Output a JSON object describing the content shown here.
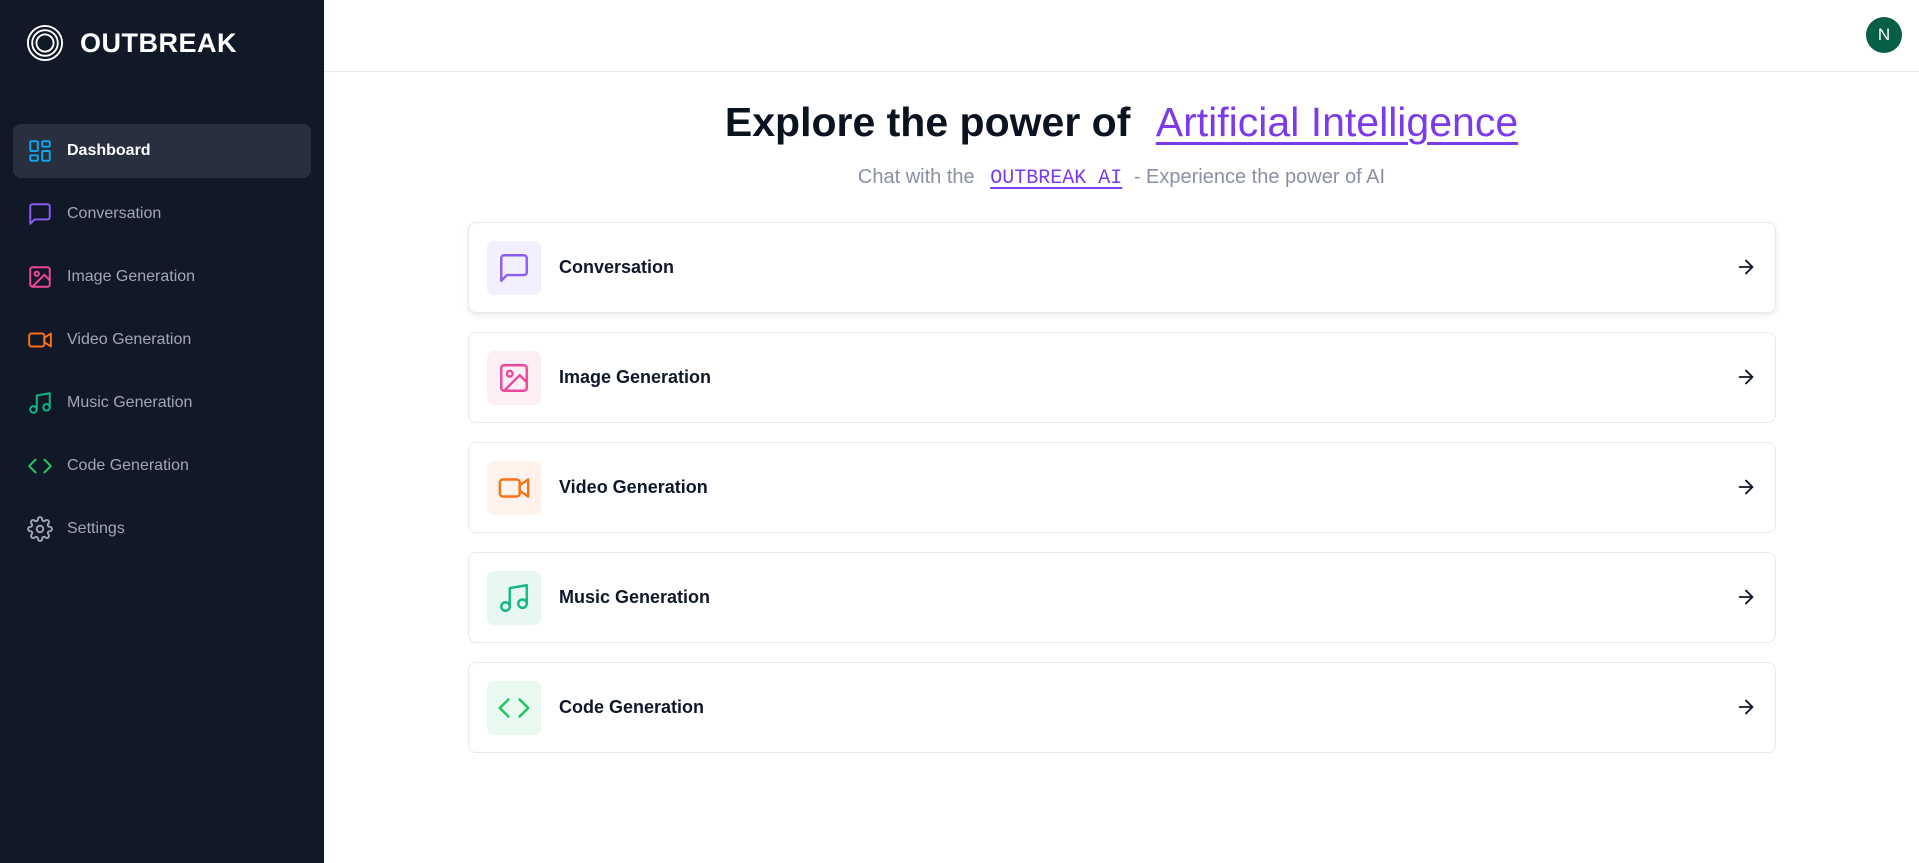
{
  "brand": {
    "name": "OUTBREAK"
  },
  "sidebar": {
    "items": [
      {
        "label": "Dashboard",
        "icon": "dashboard-icon",
        "color": "#0ea5e9",
        "active": true
      },
      {
        "label": "Conversation",
        "icon": "message-icon",
        "color": "#8b5cf6"
      },
      {
        "label": "Image Generation",
        "icon": "image-icon",
        "color": "#ec4899"
      },
      {
        "label": "Video Generation",
        "icon": "video-icon",
        "color": "#f97316"
      },
      {
        "label": "Music Generation",
        "icon": "music-icon",
        "color": "#10b981"
      },
      {
        "label": "Code Generation",
        "icon": "code-icon",
        "color": "#22c55e"
      },
      {
        "label": "Settings",
        "icon": "gear-icon",
        "color": "#9ca3af"
      }
    ]
  },
  "header": {
    "avatar_initial": "N"
  },
  "hero": {
    "title_prefix": "Explore the power of",
    "title_accent": "Artificial Intelligence",
    "sub_prefix": "Chat with the",
    "sub_code": "OUTBREAK AI",
    "sub_suffix": "- Experience the power of AI"
  },
  "cards": [
    {
      "label": "Conversation",
      "icon": "message-icon",
      "color": "#8b5cf6",
      "bg": "#f3effe"
    },
    {
      "label": "Image Generation",
      "icon": "image-icon",
      "color": "#ec4899",
      "bg": "#fdeef6"
    },
    {
      "label": "Video Generation",
      "icon": "video-icon",
      "color": "#f97316",
      "bg": "#fef2ea"
    },
    {
      "label": "Music Generation",
      "icon": "music-icon",
      "color": "#10b981",
      "bg": "#e8f8f1"
    },
    {
      "label": "Code Generation",
      "icon": "code-icon",
      "color": "#22c55e",
      "bg": "#e9f9ef"
    }
  ]
}
